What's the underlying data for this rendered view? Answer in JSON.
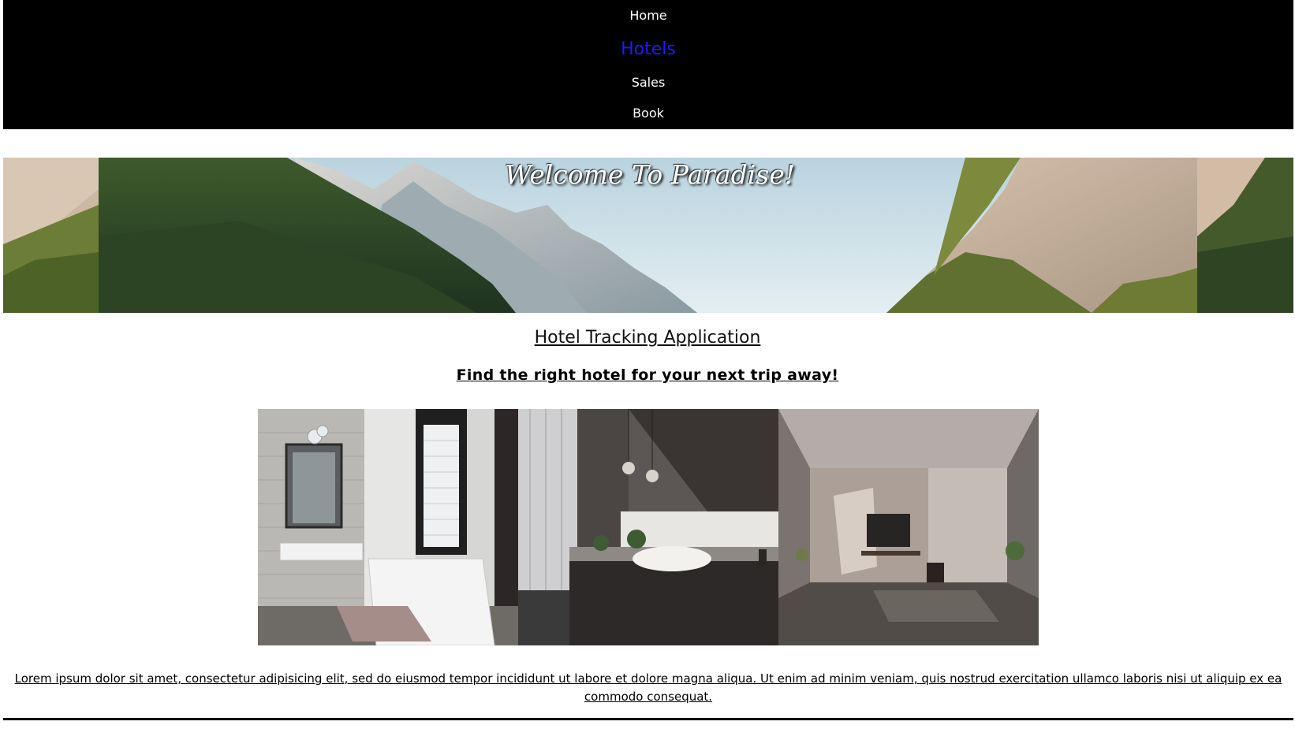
{
  "nav": {
    "items": [
      {
        "label": "Home"
      },
      {
        "label": "Hotels",
        "active": true
      },
      {
        "label": "Sales"
      },
      {
        "label": "Book"
      }
    ],
    "active_color": "#1a1aff",
    "background": "#000000"
  },
  "banner": {
    "title": "Welcome To Paradise!",
    "image": "mountain-valley-banner"
  },
  "main": {
    "title": "Hotel Tracking Application",
    "tagline": "Find the right hotel for your next trip away!",
    "gallery": [
      {
        "image": "bathroom-bathtub-photo"
      },
      {
        "image": "bathroom-sink-photo"
      },
      {
        "image": "living-room-photo"
      }
    ],
    "body_text": "Lorem ipsum dolor sit amet, consectetur adipisicing elit, sed do eiusmod tempor incididunt ut labore et dolore magna aliqua. Ut enim ad minim veniam, quis nostrud exercitation ullamco laboris nisi ut aliquip ex ea commodo consequat."
  }
}
